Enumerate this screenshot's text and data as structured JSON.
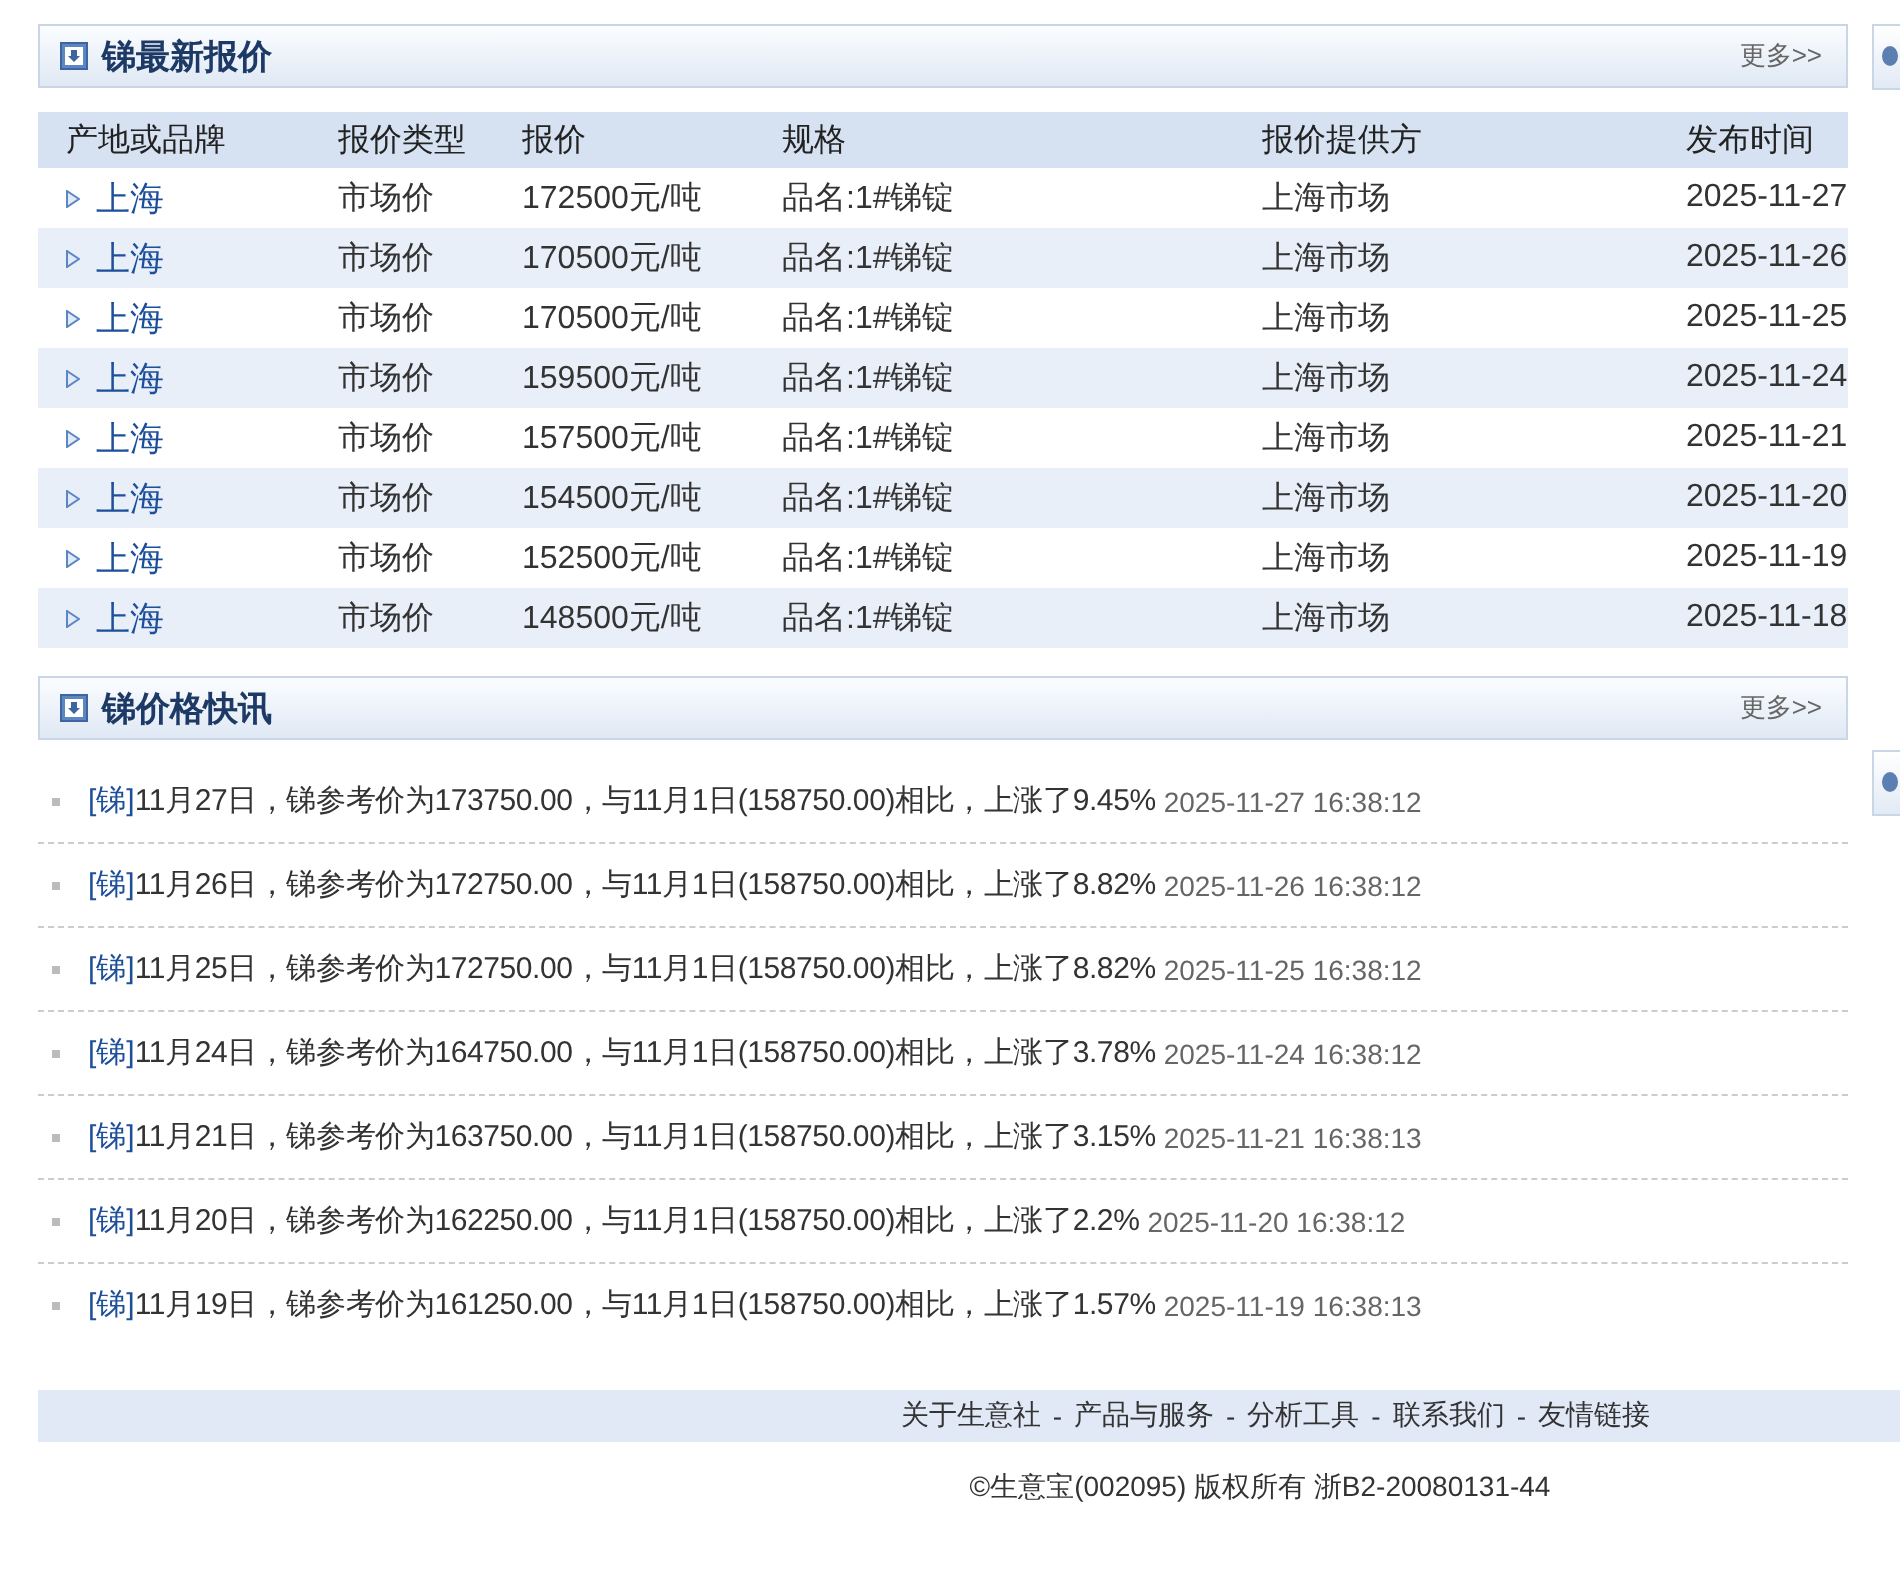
{
  "quotes_panel": {
    "title": "锑最新报价",
    "more": "更多>>"
  },
  "quotes_table": {
    "columns": [
      "产地或品牌",
      "报价类型",
      "报价",
      "规格",
      "报价提供方",
      "发布时间"
    ],
    "rows": [
      {
        "cells": [
          "上海",
          "市场价",
          "172500元/吨",
          "品名:1#锑锭",
          "上海市场",
          "2025-11-27"
        ]
      },
      {
        "cells": [
          "上海",
          "市场价",
          "170500元/吨",
          "品名:1#锑锭",
          "上海市场",
          "2025-11-26"
        ]
      },
      {
        "cells": [
          "上海",
          "市场价",
          "170500元/吨",
          "品名:1#锑锭",
          "上海市场",
          "2025-11-25"
        ]
      },
      {
        "cells": [
          "上海",
          "市场价",
          "159500元/吨",
          "品名:1#锑锭",
          "上海市场",
          "2025-11-24"
        ]
      },
      {
        "cells": [
          "上海",
          "市场价",
          "157500元/吨",
          "品名:1#锑锭",
          "上海市场",
          "2025-11-21"
        ]
      },
      {
        "cells": [
          "上海",
          "市场价",
          "154500元/吨",
          "品名:1#锑锭",
          "上海市场",
          "2025-11-20"
        ]
      },
      {
        "cells": [
          "上海",
          "市场价",
          "152500元/吨",
          "品名:1#锑锭",
          "上海市场",
          "2025-11-19"
        ]
      },
      {
        "cells": [
          "上海",
          "市场价",
          "148500元/吨",
          "品名:1#锑锭",
          "上海市场",
          "2025-11-18"
        ]
      }
    ]
  },
  "news_panel": {
    "title": "锑价格快讯",
    "more": "更多>>"
  },
  "news": [
    {
      "tag": "[锑]",
      "text": "11月27日，锑参考价为173750.00，与11月1日(158750.00)相比，上涨了9.45%",
      "time": "2025-11-27 16:38:12"
    },
    {
      "tag": "[锑]",
      "text": "11月26日，锑参考价为172750.00，与11月1日(158750.00)相比，上涨了8.82%",
      "time": "2025-11-26 16:38:12"
    },
    {
      "tag": "[锑]",
      "text": "11月25日，锑参考价为172750.00，与11月1日(158750.00)相比，上涨了8.82%",
      "time": "2025-11-25 16:38:12"
    },
    {
      "tag": "[锑]",
      "text": "11月24日，锑参考价为164750.00，与11月1日(158750.00)相比，上涨了3.78%",
      "time": "2025-11-24 16:38:12"
    },
    {
      "tag": "[锑]",
      "text": "11月21日，锑参考价为163750.00，与11月1日(158750.00)相比，上涨了3.15%",
      "time": "2025-11-21 16:38:13"
    },
    {
      "tag": "[锑]",
      "text": "11月20日，锑参考价为162250.00，与11月1日(158750.00)相比，上涨了2.2%",
      "time": "2025-11-20 16:38:12"
    },
    {
      "tag": "[锑]",
      "text": "11月19日，锑参考价为161250.00，与11月1日(158750.00)相比，上涨了1.57%",
      "time": "2025-11-19 16:38:13"
    }
  ],
  "footer": {
    "links": [
      {
        "text": "关于生意社",
        "separator": "-"
      },
      {
        "text": "产品与服务",
        "separator": "-"
      },
      {
        "text": "分析工具",
        "separator": "-"
      },
      {
        "text": "联系我们",
        "separator": "-"
      },
      {
        "text": "友情链接"
      }
    ],
    "copyright": "©生意宝(002095) 版权所有 浙B2-20080131-44"
  }
}
